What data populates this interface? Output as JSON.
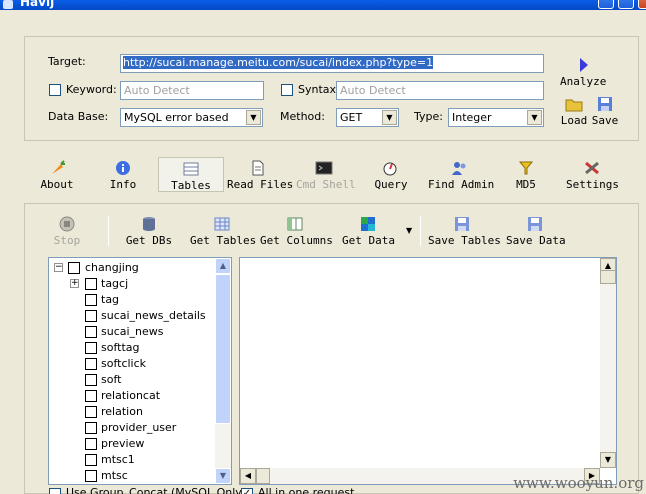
{
  "window": {
    "title": "Havij"
  },
  "form": {
    "target_label": "Target:",
    "target_value": "http://sucai.manage.meitu.com/sucai/index.php?type=1",
    "keyword_label": "Keyword:",
    "keyword_placeholder": "Auto Detect",
    "syntax_label": "Syntax:",
    "syntax_placeholder": "Auto Detect",
    "database_label": "Data Base:",
    "database_value": "MySQL error based",
    "method_label": "Method:",
    "method_value": "GET",
    "type_label": "Type:",
    "type_value": "Integer",
    "analyze_label": "Analyze",
    "load_label": "Load",
    "save_label": "Save"
  },
  "main_toolbar": [
    {
      "id": "about",
      "label": "About",
      "icon": "carrot-icon"
    },
    {
      "id": "info",
      "label": "Info",
      "icon": "info-icon"
    },
    {
      "id": "tables",
      "label": "Tables",
      "icon": "tables-icon",
      "selected": true
    },
    {
      "id": "read-files",
      "label": "Read Files",
      "icon": "document-icon"
    },
    {
      "id": "cmd-shell",
      "label": "Cmd Shell",
      "icon": "terminal-icon",
      "disabled": true
    },
    {
      "id": "query",
      "label": "Query",
      "icon": "query-icon"
    },
    {
      "id": "find-admin",
      "label": "Find Admin",
      "icon": "users-icon"
    },
    {
      "id": "md5",
      "label": "MD5",
      "icon": "md5-icon"
    },
    {
      "id": "settings",
      "label": "Settings",
      "icon": "tools-icon"
    }
  ],
  "tables_toolbar": [
    {
      "id": "stop",
      "label": "Stop",
      "icon": "stop-icon",
      "disabled": true
    },
    {
      "id": "get-dbs",
      "label": "Get DBs",
      "icon": "database-icon"
    },
    {
      "id": "get-tables",
      "label": "Get Tables",
      "icon": "table-grid-icon"
    },
    {
      "id": "get-columns",
      "label": "Get Columns",
      "icon": "columns-icon"
    },
    {
      "id": "get-data",
      "label": "Get Data",
      "icon": "data-icon"
    },
    {
      "id": "save-tables",
      "label": "Save Tables",
      "icon": "floppy-icon"
    },
    {
      "id": "save-data",
      "label": "Save Data",
      "icon": "floppy-icon"
    }
  ],
  "tree": {
    "root": "changjing",
    "items": [
      "tagcj",
      "tag",
      "sucai_news_details",
      "sucai_news",
      "softtag",
      "softclick",
      "soft",
      "relationcat",
      "relation",
      "provider_user",
      "preview",
      "mtsc1",
      "mtsc"
    ]
  },
  "options": {
    "group_concat_label": "Use Group_Concat (MySQL Only)",
    "all_in_one_label": "All in one request"
  },
  "watermark": "www.wooyun.org"
}
